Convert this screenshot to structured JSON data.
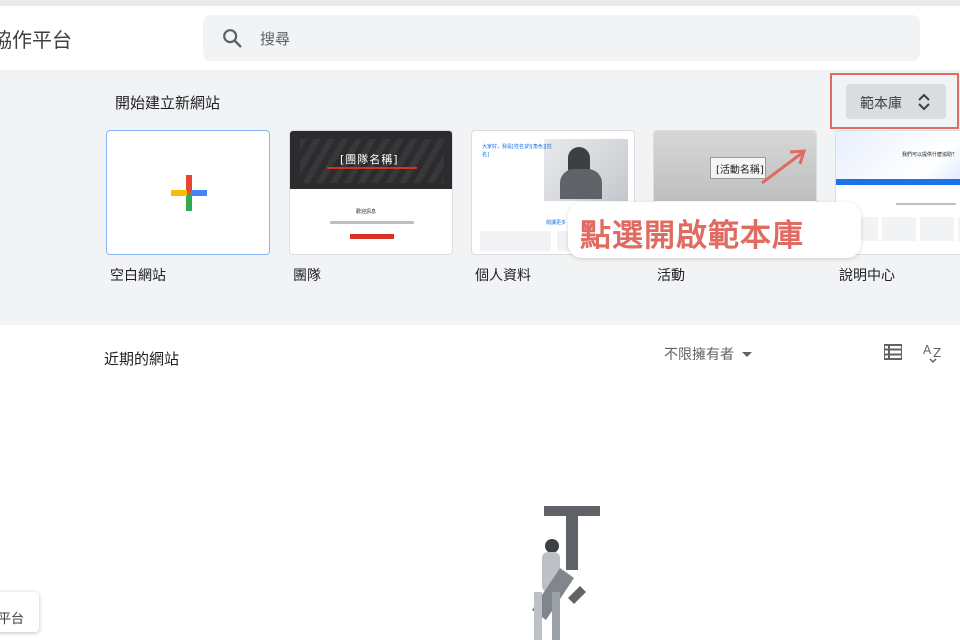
{
  "header": {
    "app_title": "協作平台",
    "search_placeholder": "搜尋"
  },
  "gallery": {
    "title": "開始建立新網站",
    "template_button_label": "範本庫",
    "templates": [
      {
        "label": "空白網站"
      },
      {
        "label": "團隊",
        "thumb_title": "[團隊名稱]",
        "thumb_sub": "歡迎訊息"
      },
      {
        "label": "個人資料",
        "thumb_text": "大家好，我是[姓名]的[角色][姓名]",
        "thumb_link": "閱讀更多"
      },
      {
        "label": "活動",
        "thumb_title": "[活動名稱]"
      },
      {
        "label": "說明中心",
        "thumb_text": "我們可以提供什麼協助？"
      }
    ]
  },
  "annotation": {
    "text": "點選開啟範本庫",
    "color": "#e06b62"
  },
  "recent": {
    "title": "近期的網站",
    "owner_filter": "不限擁有者"
  },
  "bottom_chip": {
    "text": "平台"
  },
  "colors": {
    "accent_blue": "#4285f4",
    "accent_red": "#ea4335",
    "accent_yellow": "#fbbc04",
    "accent_green": "#34a853",
    "highlight": "#e06b62"
  }
}
